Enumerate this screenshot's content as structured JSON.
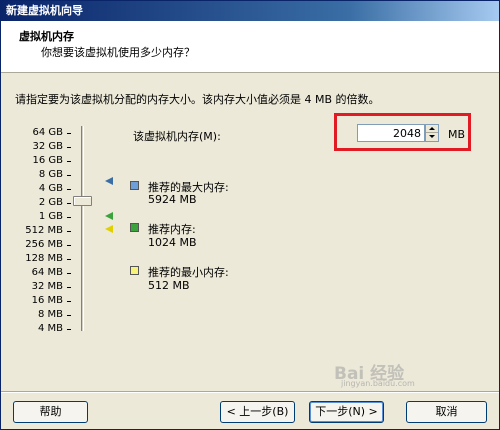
{
  "window": {
    "title": "新建虚拟机向导"
  },
  "header": {
    "title": "虚拟机内存",
    "subtitle": "你想要该虚拟机使用多少内存？"
  },
  "instruction": "请指定要为该虚拟机分配的内存大小。该内存大小值必须是 4 MB 的倍数。",
  "memory": {
    "label": "该虚拟机内存(M):",
    "value": "2048",
    "unit": "MB"
  },
  "slider": {
    "ticks": [
      "64 GB",
      "32 GB",
      "16 GB",
      "8 GB",
      "4 GB",
      "2 GB",
      "1 GB",
      "512 MB",
      "256 MB",
      "128 MB",
      "64 MB",
      "32 MB",
      "16 MB",
      "8 MB",
      "4 MB"
    ],
    "current": "2 GB"
  },
  "legend": [
    {
      "title": "推荐的最大内存:",
      "value": "5924 MB",
      "color": "#6F9FD8"
    },
    {
      "title": "推荐内存:",
      "value": "1024 MB",
      "color": "#3BA33B"
    },
    {
      "title": "推荐的最小内存:",
      "value": "512 MB",
      "color": "#F7F27A"
    }
  ],
  "buttons": {
    "help": "帮助",
    "back": "< 上一步(B)",
    "next": "下一步(N) >",
    "cancel": "取消"
  },
  "watermark": {
    "text": "Bai 经验",
    "url": "jingyan.baidu.com"
  },
  "colors": {
    "highlight": "#E01B24",
    "title_bar": "#0A246A"
  }
}
